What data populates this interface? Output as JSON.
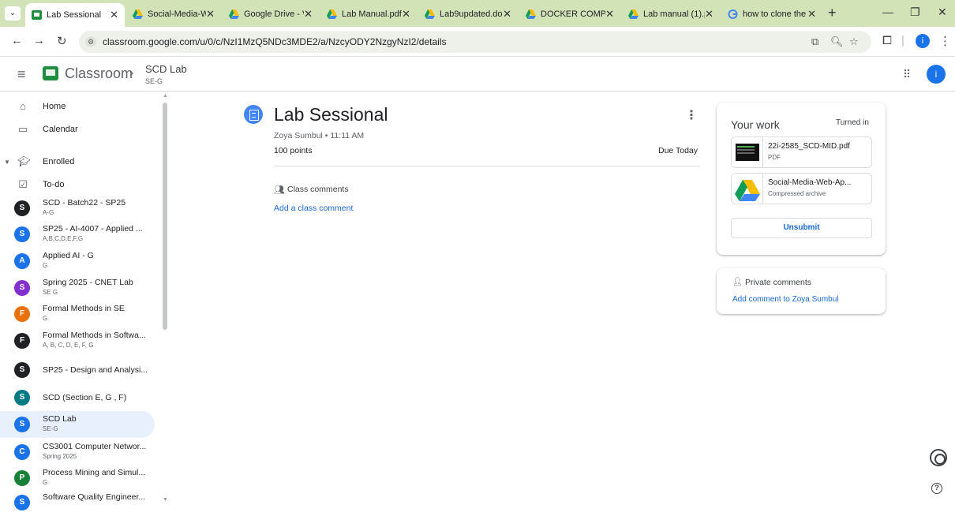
{
  "browser": {
    "tabs": [
      {
        "title": "Lab Sessional",
        "favicon": "classroom-icon",
        "active": true
      },
      {
        "title": "Social-Media-W",
        "favicon": "drive-icon"
      },
      {
        "title": "Google Drive - V",
        "favicon": "drive-icon"
      },
      {
        "title": "Lab Manual.pdf",
        "favicon": "drive-icon"
      },
      {
        "title": "Lab9updated.do",
        "favicon": "drive-icon"
      },
      {
        "title": "DOCKER COMP",
        "favicon": "drive-icon"
      },
      {
        "title": "Lab manual (1).p",
        "favicon": "drive-icon"
      },
      {
        "title": "how to clone the",
        "favicon": "google-icon"
      }
    ],
    "url": "classroom.google.com/u/0/c/NzI1MzQ5NDc3MDE2/a/NzcyODY2NzgyNzI2/details",
    "profile_initial": "i"
  },
  "header": {
    "brand": "Classroom",
    "class_name": "SCD Lab",
    "class_section": "SE-G",
    "avatar_initial": "i"
  },
  "sidebar": {
    "home": "Home",
    "calendar": "Calendar",
    "enrolled": "Enrolled",
    "todo": "To-do",
    "courses": [
      {
        "initial": "S",
        "name": "SCD - Batch22 - SP25",
        "section": "A-G",
        "color": "#202124"
      },
      {
        "initial": "S",
        "name": "SP25 - AI-4007 - Applied ...",
        "section": "A,B,C,D,E,F,G",
        "color": "#1a73e8"
      },
      {
        "initial": "A",
        "name": "Applied AI - G",
        "section": "G",
        "color": "#1a73e8"
      },
      {
        "initial": "S",
        "name": "Spring 2025 - CNET Lab",
        "section": "SE G",
        "color": "#8430ce"
      },
      {
        "initial": "F",
        "name": "Formal Methods in SE",
        "section": "G",
        "color": "#e8710a"
      },
      {
        "initial": "F",
        "name": "Formal Methods in Softwa...",
        "section": "A, B, C, D, E, F, G",
        "color": "#202124"
      },
      {
        "initial": "S",
        "name": "SP25 - Design and Analysi...",
        "section": "",
        "color": "#202124"
      },
      {
        "initial": "S",
        "name": "SCD (Section E, G , F)",
        "section": "",
        "color": "#007b83"
      },
      {
        "initial": "S",
        "name": "SCD Lab",
        "section": "SE-G",
        "color": "#1a73e8",
        "selected": true
      },
      {
        "initial": "C",
        "name": "CS3001 Computer Networ...",
        "section": "Spring 2025",
        "color": "#1a73e8"
      },
      {
        "initial": "P",
        "name": "Process Mining and Simul...",
        "section": "G",
        "color": "#188038"
      },
      {
        "initial": "S",
        "name": "Software Quality Engineer...",
        "section": "",
        "color": "#1a73e8"
      }
    ]
  },
  "assignment": {
    "title": "Lab Sessional",
    "meta": "Zoya Sumbul • 11:11 AM",
    "points": "100 points",
    "due": "Due Today",
    "class_comments_label": "Class comments",
    "add_class_comment": "Add a class comment"
  },
  "your_work": {
    "title": "Your work",
    "status": "Turned in",
    "attachments": [
      {
        "name": "22i-2585_SCD-MID.pdf",
        "type": "PDF"
      },
      {
        "name": "Social-Media-Web-Ap...",
        "type": "Compressed archive"
      }
    ],
    "unsubmit_label": "Unsubmit"
  },
  "private_comments": {
    "label": "Private comments",
    "add_label": "Add comment to Zoya Sumbul"
  }
}
